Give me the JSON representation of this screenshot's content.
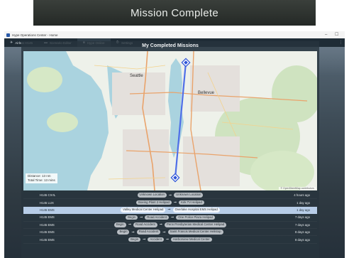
{
  "banner": {
    "title": "Mission Complete"
  },
  "window": {
    "title": "Hype Operations Center - Home",
    "controls": {
      "minimize": "–",
      "maximize": "☐",
      "close": ""
    }
  },
  "tabs": [
    {
      "label": "Airbus H145",
      "icon": "helicopter-icon"
    },
    {
      "label": "Scenario Editor",
      "icon": "folder-icon"
    },
    {
      "label": "Hype Online",
      "icon": "globe-icon"
    },
    {
      "label": "Settings",
      "icon": "gear-icon"
    }
  ],
  "panel": {
    "title": "My Completed Missions"
  },
  "map": {
    "labels": {
      "seattle": "Seattle",
      "bellevue": "Bellevue",
      "everett": ""
    },
    "distance": "Distance: 13 nm",
    "total_time": "Total Time: 13 mins",
    "credit": "© OpenStreetMap contributors",
    "route_color": "#4f6fe8",
    "start_marker": "diamond-marker-icon",
    "end_marker": "diamond-marker-icon"
  },
  "missions": [
    {
      "aircraft": "H145 CIVIL",
      "stops": [
        "Unknown Location",
        "Unknown Location"
      ],
      "ago": "4 hours ago",
      "selected": false
    },
    {
      "aircraft": "H145 LUX",
      "stops": [
        "Boeing Plant 2 Helipad",
        "Kirk TV Helipad"
      ],
      "ago": "1 day ago",
      "selected": false
    },
    {
      "aircraft": "H145 EMS",
      "stops": [
        "Valley Medical Center Helipad",
        "Overlake Hospital EMS Helipad"
      ],
      "ago": "1 day ago",
      "selected": true
    },
    {
      "aircraft": "H145 EMS",
      "stops": [
        "Begin",
        "Road Accident",
        "One Police Plaza Helipad"
      ],
      "ago": "7 days ago",
      "selected": false
    },
    {
      "aircraft": "H145 EMS",
      "stops": [
        "Begin",
        "Road Accident",
        "Penn Presbyterian Medical Center Helipad"
      ],
      "ago": "7 days ago",
      "selected": false
    },
    {
      "aircraft": "H145 EMS",
      "stops": [
        "Begin",
        "Road Accident",
        "Saint Francis Medical Center Helistop"
      ],
      "ago": "8 days ago",
      "selected": false
    },
    {
      "aircraft": "H145 EMS",
      "stops": [
        "Begin",
        "Accident",
        "Harborview Medical Center"
      ],
      "ago": "8 days ago",
      "selected": false
    }
  ]
}
